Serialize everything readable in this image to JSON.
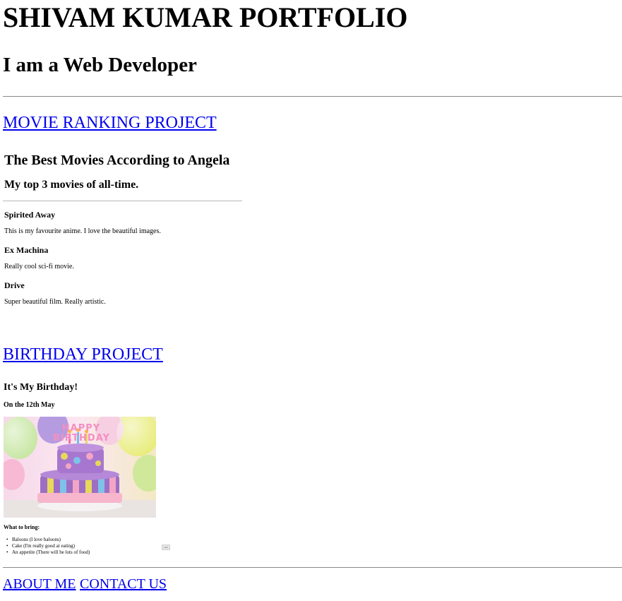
{
  "header": {
    "title": "SHIVAM KUMAR PORTFOLIO",
    "subtitle": "I am a Web Developer"
  },
  "projects": {
    "movie": {
      "link_label": "MOVIE RANKING PROJECT",
      "heading": "The Best Movies According to Angela",
      "subheading": "My top 3 movies of all-time.",
      "movies": [
        {
          "title": "Spirited Away",
          "description": "This is my favourite anime. I love the beautiful images."
        },
        {
          "title": "Ex Machina",
          "description": "Really cool sci-fi movie."
        },
        {
          "title": "Drive",
          "description": "Super beautiful film. Really artistic."
        }
      ]
    },
    "birthday": {
      "link_label": "BIRTHDAY PROJECT",
      "heading": "It's My Birthday!",
      "date_text": "On the 12th May",
      "cake_topper_text": "HAPPY BIRTHDAY",
      "bring_heading": "What to bring:",
      "bring_items": [
        "Baloons (I love baloons)",
        "Cake (I'm really good at eating)",
        "An appetite (There will be lots of food)"
      ],
      "button_label": "Link"
    }
  },
  "footer": {
    "about_label": "ABOUT ME",
    "contact_label": "CONTACT US"
  },
  "colors": {
    "link": "#0000ee",
    "text": "#000000",
    "rule": "#8a8a8a"
  }
}
